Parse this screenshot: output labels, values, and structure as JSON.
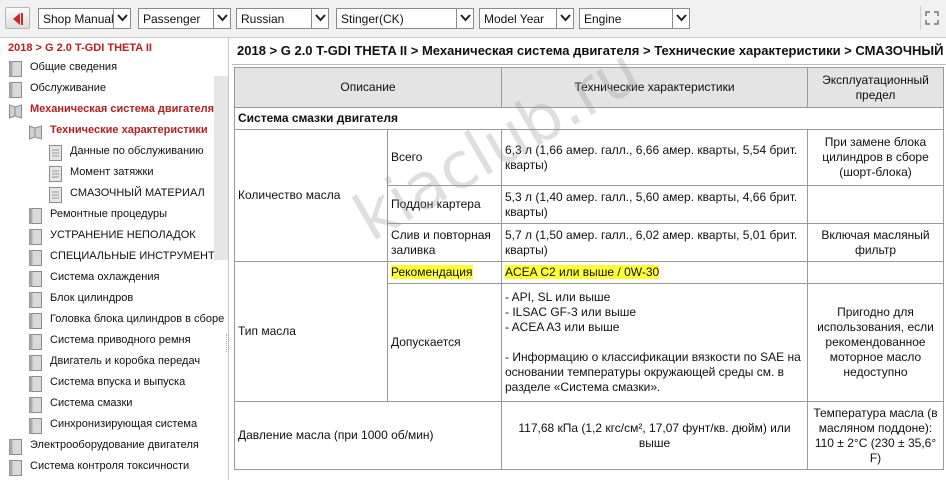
{
  "toolbar": {
    "selects": [
      {
        "value": "Shop Manual"
      },
      {
        "value": "Passenger"
      },
      {
        "value": "Russian"
      },
      {
        "value": "Stinger(CK)"
      },
      {
        "value": "Model Year"
      },
      {
        "value": "Engine"
      }
    ]
  },
  "sidebar": {
    "title": "2018 > G 2.0 T-GDI THETA II",
    "items": [
      {
        "label": "Общие сведения"
      },
      {
        "label": "Обслуживание"
      },
      {
        "label": "Механическая система двигателя"
      },
      {
        "label": "Технические характеристики"
      },
      {
        "label": "Данные по обслуживанию"
      },
      {
        "label": "Момент затяжки"
      },
      {
        "label": "СМАЗОЧНЫЙ МАТЕРИАЛ"
      },
      {
        "label": "Ремонтные процедуры"
      },
      {
        "label": "УСТРАНЕНИЕ НЕПОЛАДОК"
      },
      {
        "label": "СПЕЦИАЛЬНЫЕ ИНСТРУМЕНТЫ"
      },
      {
        "label": "Система охлаждения"
      },
      {
        "label": "Блок цилиндров"
      },
      {
        "label": "Головка блока цилиндров в сборе"
      },
      {
        "label": "Система приводного ремня"
      },
      {
        "label": "Двигатель и коробка передач"
      },
      {
        "label": "Система впуска и выпуска"
      },
      {
        "label": "Система смазки"
      },
      {
        "label": "Синхронизирующая система"
      },
      {
        "label": "Электрооборудование двигателя"
      },
      {
        "label": "Система контроля токсичности"
      }
    ]
  },
  "content": {
    "breadcrumb": "2018 > G 2.0 T-GDI THETA II > Механическая система двигателя >  Технические характеристики > СМАЗОЧНЫЙ МАТЕРИАЛ",
    "table": {
      "headers": [
        "Описание",
        "Технические характеристики",
        "Эксплуатационный предел"
      ],
      "section": "Система смазки двигателя",
      "oil_qty": {
        "label": "Количество масла",
        "total_label": "Всего",
        "total_value": "6,3 л (1,66 амер. галл., 6,66 амер. кварты, 5,54 брит. кварты)",
        "total_limit": "При замене блока цилиндров в сборе (шорт-блока)",
        "pan_label": "Поддон картера",
        "pan_value": "5,3 л (1,40 амер. галл., 5,60 амер. кварты, 4,66 брит. кварты)",
        "drain_label": "Слив и повторная заливка",
        "drain_value": "5,7 л (1,50 амер. галл., 6,02 амер. кварты, 5,01 брит. кварты)",
        "drain_limit": "Включая масляный фильтр"
      },
      "oil_type": {
        "label": "Тип масла",
        "rec_label": "Рекомендация",
        "rec_value": "ACEA C2 или выше / 0W-30",
        "allowed_label": "Допускается",
        "allowed_items": [
          "- API, SL или выше",
          "- ILSAC GF-3 или выше",
          "- ACEA A3 или выше"
        ],
        "allowed_note": "- Информацию о классификации вязкости по SAE на основании температуры окружающей среды см. в разделе «Система смазки».",
        "allowed_limit": "Пригодно для использования, если рекомендованное моторное масло недоступно"
      },
      "pressure": {
        "label": "Давление масла (при 1000 об/мин)",
        "value": "117,68 кПа (1,2 кгс/см², 17,07 фунт/кв. дюйм) или выше",
        "limit": "Температура масла (в масляном поддоне): 110 ± 2°C (230 ± 35,6° F)"
      }
    }
  },
  "watermark": "kiaclub.ru",
  "colors": {
    "accent_red": "#b22222",
    "highlight": "#ffff33"
  }
}
